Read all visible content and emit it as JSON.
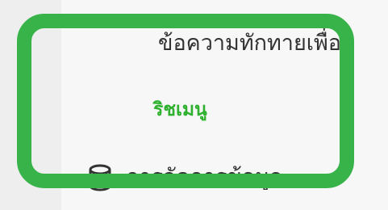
{
  "content": {
    "welcome_text": "ข้อความทักทายเพื่อ",
    "section_heading": "ริชเมนู",
    "menu_item_label": "การจัดการข้อมูล"
  },
  "icons": {
    "menu_item_icon": "database-icon"
  },
  "colors": {
    "highlight_frame": "#37b34a",
    "section_heading": "#2fb12f",
    "text": "#333333",
    "background": "#f2f2f2"
  }
}
